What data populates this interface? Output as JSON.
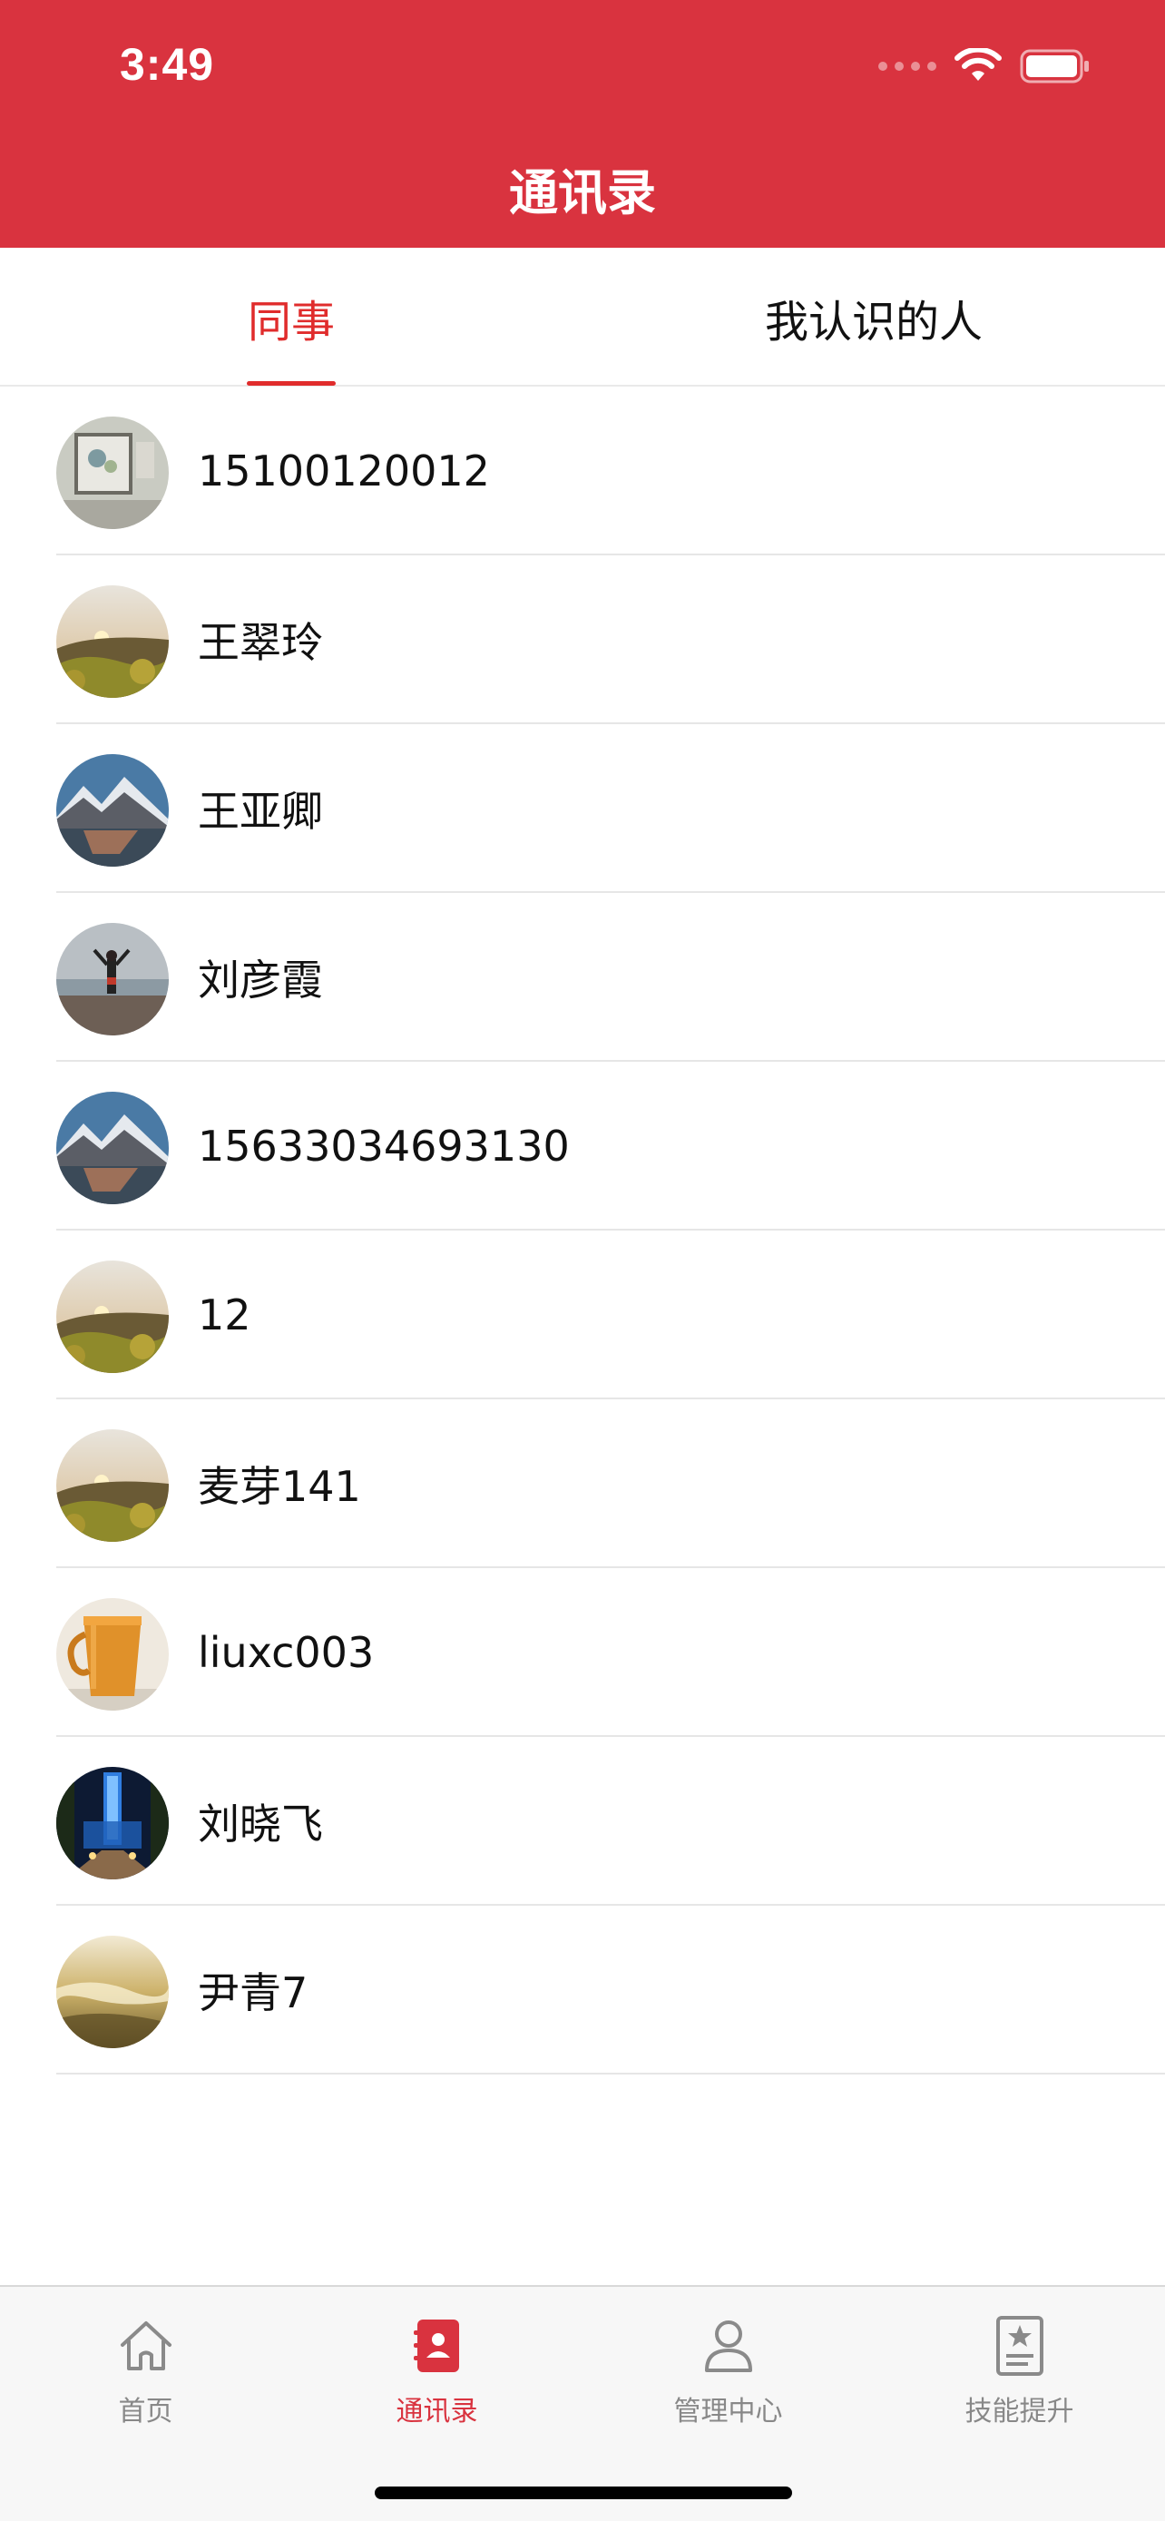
{
  "status_bar": {
    "time": "3:49",
    "wifi_icon": "wifi-icon",
    "battery_icon": "battery-icon"
  },
  "header": {
    "title": "通讯录",
    "background": "#d9333f"
  },
  "tabs": [
    {
      "label": "同事",
      "active": true
    },
    {
      "label": "我认识的人",
      "active": false
    }
  ],
  "colors": {
    "accent": "#e02c2c",
    "inactive": "#888888"
  },
  "contacts": [
    {
      "name": "15100120012",
      "avatar": "picture-frame-photo"
    },
    {
      "name": "王翠玲",
      "avatar": "sunset-hills-photo"
    },
    {
      "name": "王亚卿",
      "avatar": "mountain-lake-photo"
    },
    {
      "name": "刘彦霞",
      "avatar": "beach-person-photo"
    },
    {
      "name": "15633034693130",
      "avatar": "mountain-lake-photo"
    },
    {
      "name": "12",
      "avatar": "sunset-hills-photo"
    },
    {
      "name": "麦芽141",
      "avatar": "sunset-hills-photo"
    },
    {
      "name": "liuxc003",
      "avatar": "coffee-mug-photo"
    },
    {
      "name": "刘晓飞",
      "avatar": "night-tower-photo"
    },
    {
      "name": "尹青7",
      "avatar": "golden-sand-photo"
    }
  ],
  "tabbar": [
    {
      "label": "首页",
      "icon": "home-icon",
      "active": false
    },
    {
      "label": "通讯录",
      "icon": "contacts-book-icon",
      "active": true
    },
    {
      "label": "管理中心",
      "icon": "person-icon",
      "active": false
    },
    {
      "label": "技能提升",
      "icon": "star-book-icon",
      "active": false
    }
  ]
}
